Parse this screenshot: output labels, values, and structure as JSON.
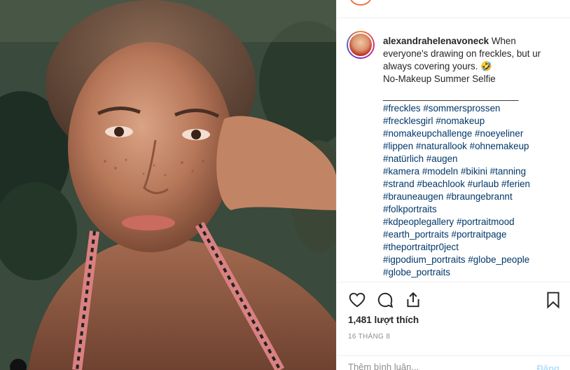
{
  "post": {
    "username": "alexandrahelenavoneck",
    "caption_lines": [
      "When everyone's drawing on freckles, but ur always covering yours. 🤣",
      "No-Makeup Summer Selfie",
      "__________________________"
    ],
    "caption_first": "When",
    "caption_wrap_1": "everyone's drawing on freckles, but ur",
    "caption_wrap_2": "always covering yours. 🤣",
    "caption_line_2": "No-Makeup Summer Selfie",
    "caption_divider": "__________________________",
    "hashtag_rows": [
      [
        "#freckles",
        "#sommersprossen"
      ],
      [
        "#frecklesgirl",
        "#nomakeup"
      ],
      [
        "#nomakeupchallenge",
        "#noeyeliner"
      ],
      [
        "#lippen",
        "#naturallook",
        "#ohnemakeup"
      ],
      [
        "#natürlich",
        "#augen"
      ],
      [
        "#kamera",
        "#modeln",
        "#bikini",
        "#tanning"
      ],
      [
        "#strand",
        "#beachlook",
        "#urlaub",
        "#ferien"
      ],
      [
        "#brauneaugen",
        "#braungebrannt"
      ],
      [
        "#folkportraits"
      ],
      [
        "#kdpeoplegallery",
        "#portraitmood"
      ],
      [
        "#earth_portraits",
        "#portraitpage"
      ],
      [
        "#theportraitpr0ject"
      ],
      [
        "#igpodium_portraits",
        "#globe_people"
      ],
      [
        "#globe_portraits"
      ]
    ],
    "likes": "1,481 lượt thích",
    "date": "16 THÁNG 8"
  },
  "actions": {
    "like_icon": "heart-icon",
    "comment_icon": "comment-icon",
    "share_icon": "share-icon",
    "save_icon": "bookmark-icon"
  },
  "comment": {
    "placeholder": "Thêm bình luận...",
    "post_label": "Đăng"
  },
  "colors": {
    "hashtag": "#00376b",
    "username": "#262626",
    "muted": "#8e8e8e",
    "post_button_disabled": "#b2dffc"
  }
}
